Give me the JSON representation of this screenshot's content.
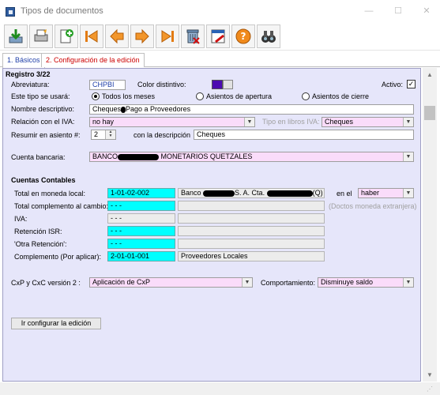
{
  "window": {
    "title": "Tipos de documentos"
  },
  "toolbar": {
    "buttons": [
      {
        "icon": "export-icon"
      },
      {
        "icon": "print-icon"
      },
      {
        "icon": "new-document-icon"
      },
      {
        "icon": "first-record-icon"
      },
      {
        "icon": "previous-record-icon"
      },
      {
        "icon": "next-record-icon"
      },
      {
        "icon": "last-record-icon"
      },
      {
        "icon": "delete-icon"
      },
      {
        "icon": "cancel-edit-icon"
      },
      {
        "icon": "help-icon"
      },
      {
        "icon": "search-binoculars-icon"
      }
    ]
  },
  "tabs": [
    {
      "label": "1. Básicos",
      "active": true
    },
    {
      "label": "2. Configuración de la edición",
      "active": false
    }
  ],
  "form": {
    "record": "Registro 3/22",
    "abbreviation_label": "Abreviatura:",
    "abbreviation_value": "CHPBI",
    "color_label": "Color distintivo:",
    "color_value": "#4b0bb0",
    "active_label": "Activo:",
    "active_checked": true,
    "usage_label": "Este tipo se usará:",
    "usage_options": [
      "Todos los meses",
      "Asientos de apertura",
      "Asientos de cierre"
    ],
    "usage_selected": 0,
    "description_label": "Nombre descriptivo:",
    "description_value_prefix": "Cheques",
    "description_value_suffix": "Pago a Proveedores",
    "iva_relation_label": "Relación con el IVA:",
    "iva_relation_value": "no hay",
    "iva_book_type_label": "Tipo en libros IVA:",
    "iva_book_type_value": "Cheques",
    "summary_label": "Resumir en asiento #:",
    "summary_value": "2",
    "with_description_label": "con la descripción",
    "with_description_value": "Cheques",
    "bank_account_label": "Cuenta bancaria:",
    "bank_account_prefix": "BANCO",
    "bank_account_suffix": "MONETARIOS QUETZALES",
    "accounts_header": "Cuentas Contables",
    "accounts": [
      {
        "label": "Total en moneda local:",
        "code": "1-01-02-002",
        "desc_a": "Banco",
        "desc_b": "S. A. Cta.",
        "desc_c": "(Q)",
        "editable": true
      },
      {
        "label": "Total complemento al cambio:",
        "code": "- - -",
        "desc": "",
        "note": "(Doctos moneda extranjera)"
      },
      {
        "label": "IVA:",
        "code": "- - -",
        "desc": ""
      },
      {
        "label": "Retención ISR:",
        "code": "- - -",
        "desc": ""
      },
      {
        "label": "'Otra Retención':",
        "code": "- - -",
        "desc": ""
      },
      {
        "label": "Complemento (Por aplicar):",
        "code": "2-01-01-001",
        "desc": "Proveedores Locales"
      }
    ],
    "in_label": "en el",
    "in_value": "haber",
    "cxp_label": "CxP y CxC versión 2 :",
    "cxp_value": "Aplicación de CxP",
    "behavior_label": "Comportamiento:",
    "behavior_value": "Disminuye saldo",
    "configure_button": "Ir configurar la edición"
  }
}
